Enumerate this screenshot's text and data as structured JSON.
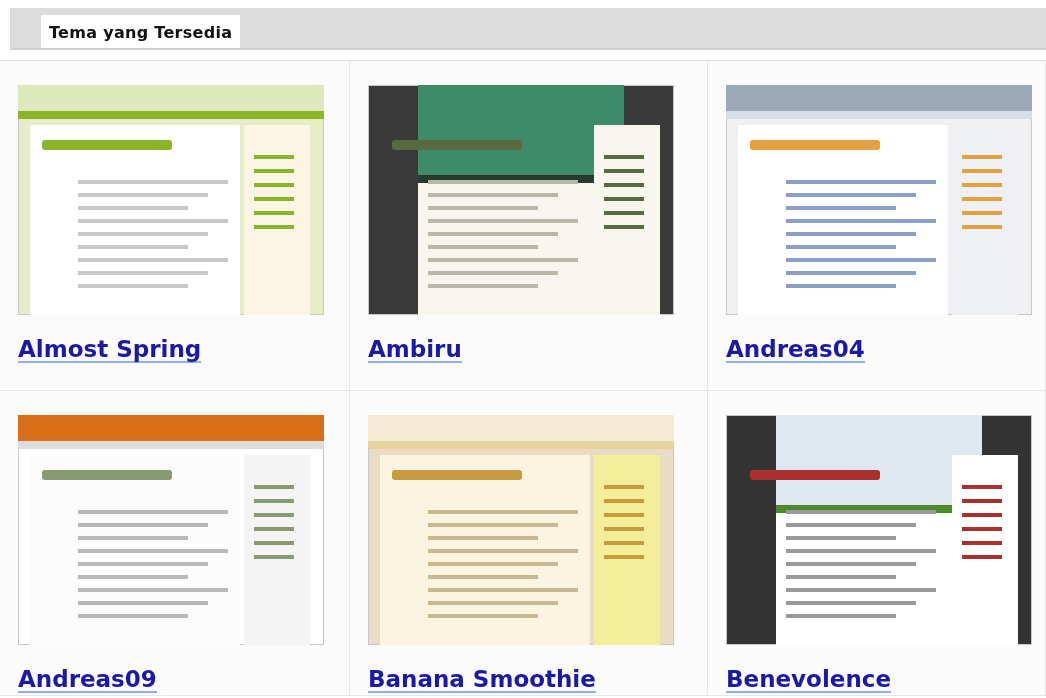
{
  "tabs": [
    {
      "label": "Tema yang Tersedia",
      "selected": true
    }
  ],
  "themes": [
    {
      "name": "Almost Spring"
    },
    {
      "name": "Ambiru"
    },
    {
      "name": "Andreas04"
    },
    {
      "name": "Andreas09"
    },
    {
      "name": "Banana Smoothie"
    },
    {
      "name": "Benevolence"
    }
  ]
}
